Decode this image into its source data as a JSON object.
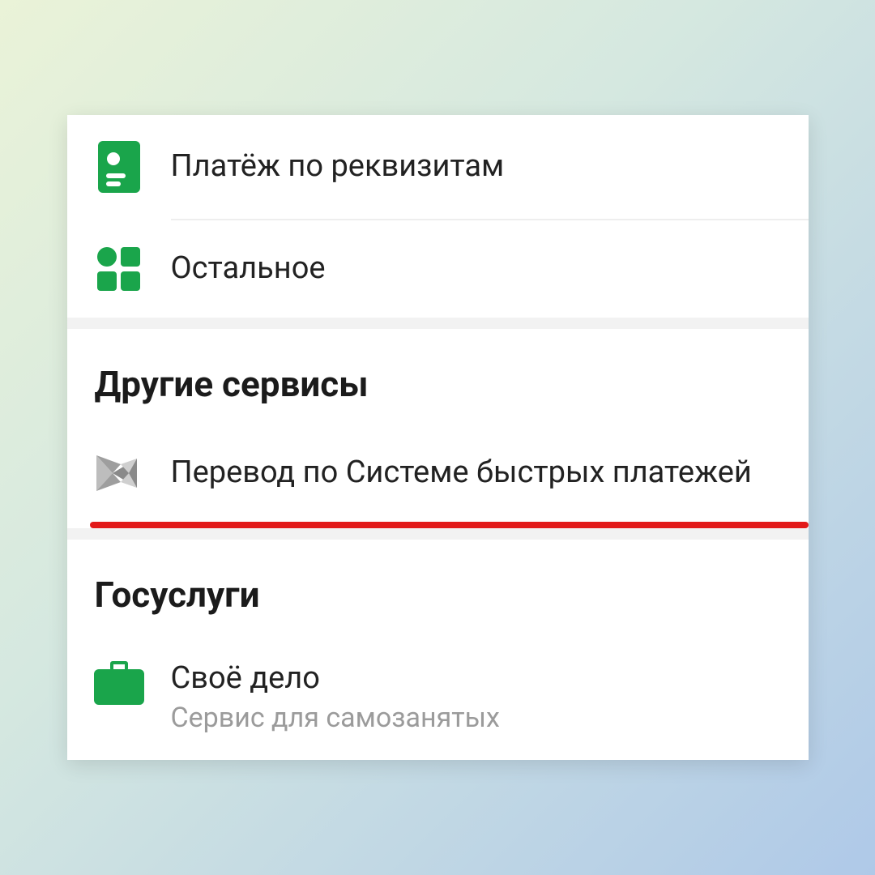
{
  "colors": {
    "accent": "#1aa54b",
    "highlight": "#e21a1a"
  },
  "top": {
    "items": [
      {
        "icon": "requisites-icon",
        "label": "Платёж по реквизитам"
      },
      {
        "icon": "grid-icon",
        "label": "Остальное"
      }
    ]
  },
  "sections": [
    {
      "title": "Другие сервисы",
      "items": [
        {
          "icon": "sbp-icon",
          "label": "Перевод по Системе быстрых платежей",
          "highlighted": true
        }
      ]
    },
    {
      "title": "Госуслуги",
      "items": [
        {
          "icon": "briefcase-icon",
          "label": "Своё дело",
          "sub": "Сервис для самозанятых"
        }
      ]
    }
  ]
}
